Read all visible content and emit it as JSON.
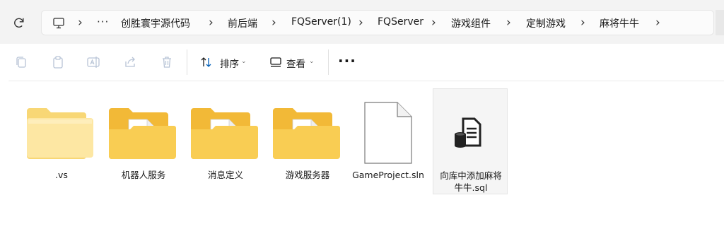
{
  "address_bar": {
    "overflow": "···",
    "crumbs": [
      "创胜寰宇源代码",
      "前后端",
      "FQServer(1)",
      "FQServer",
      "游戏组件",
      "定制游戏",
      "麻将牛牛"
    ]
  },
  "toolbar": {
    "sort_label": "排序",
    "view_label": "查看",
    "more": "···"
  },
  "files": [
    {
      "name": ".vs",
      "type": "folder-empty"
    },
    {
      "name": "机器人服务",
      "type": "folder"
    },
    {
      "name": "消息定义",
      "type": "folder"
    },
    {
      "name": "游戏服务器",
      "type": "folder"
    },
    {
      "name": "GameProject.sln",
      "type": "sln"
    },
    {
      "name_line1": "向库中添加麻将",
      "name_line2": "牛牛.sql",
      "type": "sql"
    }
  ],
  "colors": {
    "folder_light": "#fde7a3",
    "folder_dark": "#f7c548",
    "accent": "#005fb8"
  }
}
